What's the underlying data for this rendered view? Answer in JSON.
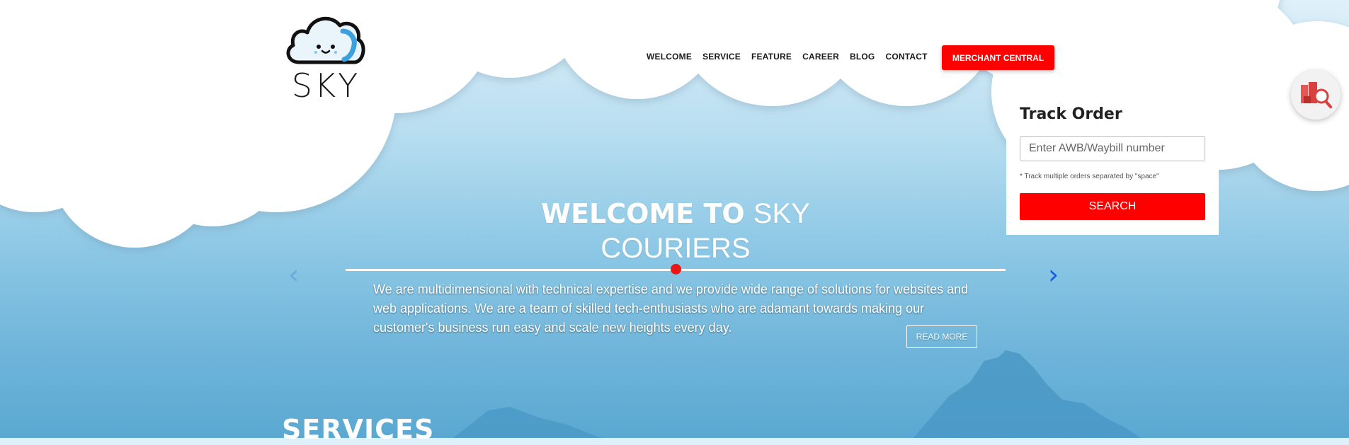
{
  "brand": {
    "name": "SKY"
  },
  "nav": {
    "items": [
      "WELCOME",
      "SERVICE",
      "FEATURE",
      "CAREER",
      "BLOG",
      "CONTACT"
    ],
    "merchant_label": "MERCHANT CENTRAL"
  },
  "track": {
    "title": "Track Order",
    "placeholder": "Enter AWB/Waybill number",
    "value": "",
    "hint": "* Track multiple orders separated by \"space\"",
    "button": "SEARCH"
  },
  "hero": {
    "title_bold": "WELCOME TO",
    "title_light_1": "SKY",
    "title_light_2": "COURIERS",
    "description": "We are multidimensional with technical expertise and we provide wide range of solutions for websites and web applications. We are a team of skilled tech-enthusiasts who are adamant towards making our customer's business run easy and scale new heights every day.",
    "read_more": "READ MORE",
    "prev_glyph": "‹",
    "next_glyph": "›"
  },
  "section": {
    "services_title": "SERVICES"
  },
  "colors": {
    "accent": "#ff0000",
    "sky": "#8fc9e6",
    "arrow_next": "#1560d8"
  },
  "icons": {
    "fab": "package-search-icon",
    "logo": "cloud-icon"
  }
}
